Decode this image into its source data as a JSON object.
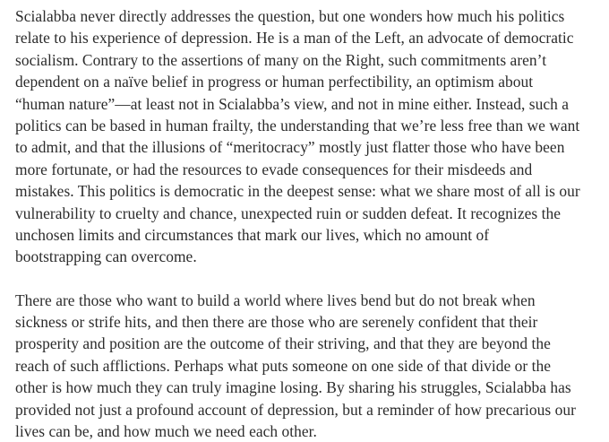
{
  "article": {
    "paragraphs": [
      {
        "lines": [
          "Scialabba never directly addresses the question, but one wonders how much his politics",
          "relate to his experience of depression. He is a man of the Left, an advocate of democratic",
          "socialism. Contrary to the assertions of many on the Right, such commitments aren’t",
          "dependent on a naïve belief in progress or human perfectibility, an optimism about",
          "“human nature”—at least not in Scialabba’s view, and not in mine either. Instead, such a",
          "politics can be based in human frailty, the understanding that we’re less free than we want",
          "to admit, and that the illusions of “meritocracy” mostly just flatter those who have been",
          "more fortunate, or had the resources to evade consequences for their misdeeds and",
          "mistakes. This politics is democratic in the deepest sense: what we share most of all is our",
          "vulnerability to cruelty and chance, unexpected ruin or sudden defeat. It recognizes the",
          "unchosen limits and circumstances that mark our lives, which no amount of",
          "bootstrapping can overcome."
        ]
      },
      {
        "lines": [
          "There are those who want to build a world where lives bend but do not break when",
          "sickness or strife hits, and then there are those who are serenely confident that their",
          "prosperity and position are the outcome of their striving, and that they are beyond the",
          "reach of such afflictions. Perhaps what puts someone on one side of that divide or the",
          "other is how much they can truly imagine losing. By sharing his struggles, Scialabba has",
          "provided not just a profound account of depression, but a reminder of how precarious our",
          "lives can be, and how much we need each other."
        ]
      }
    ]
  }
}
